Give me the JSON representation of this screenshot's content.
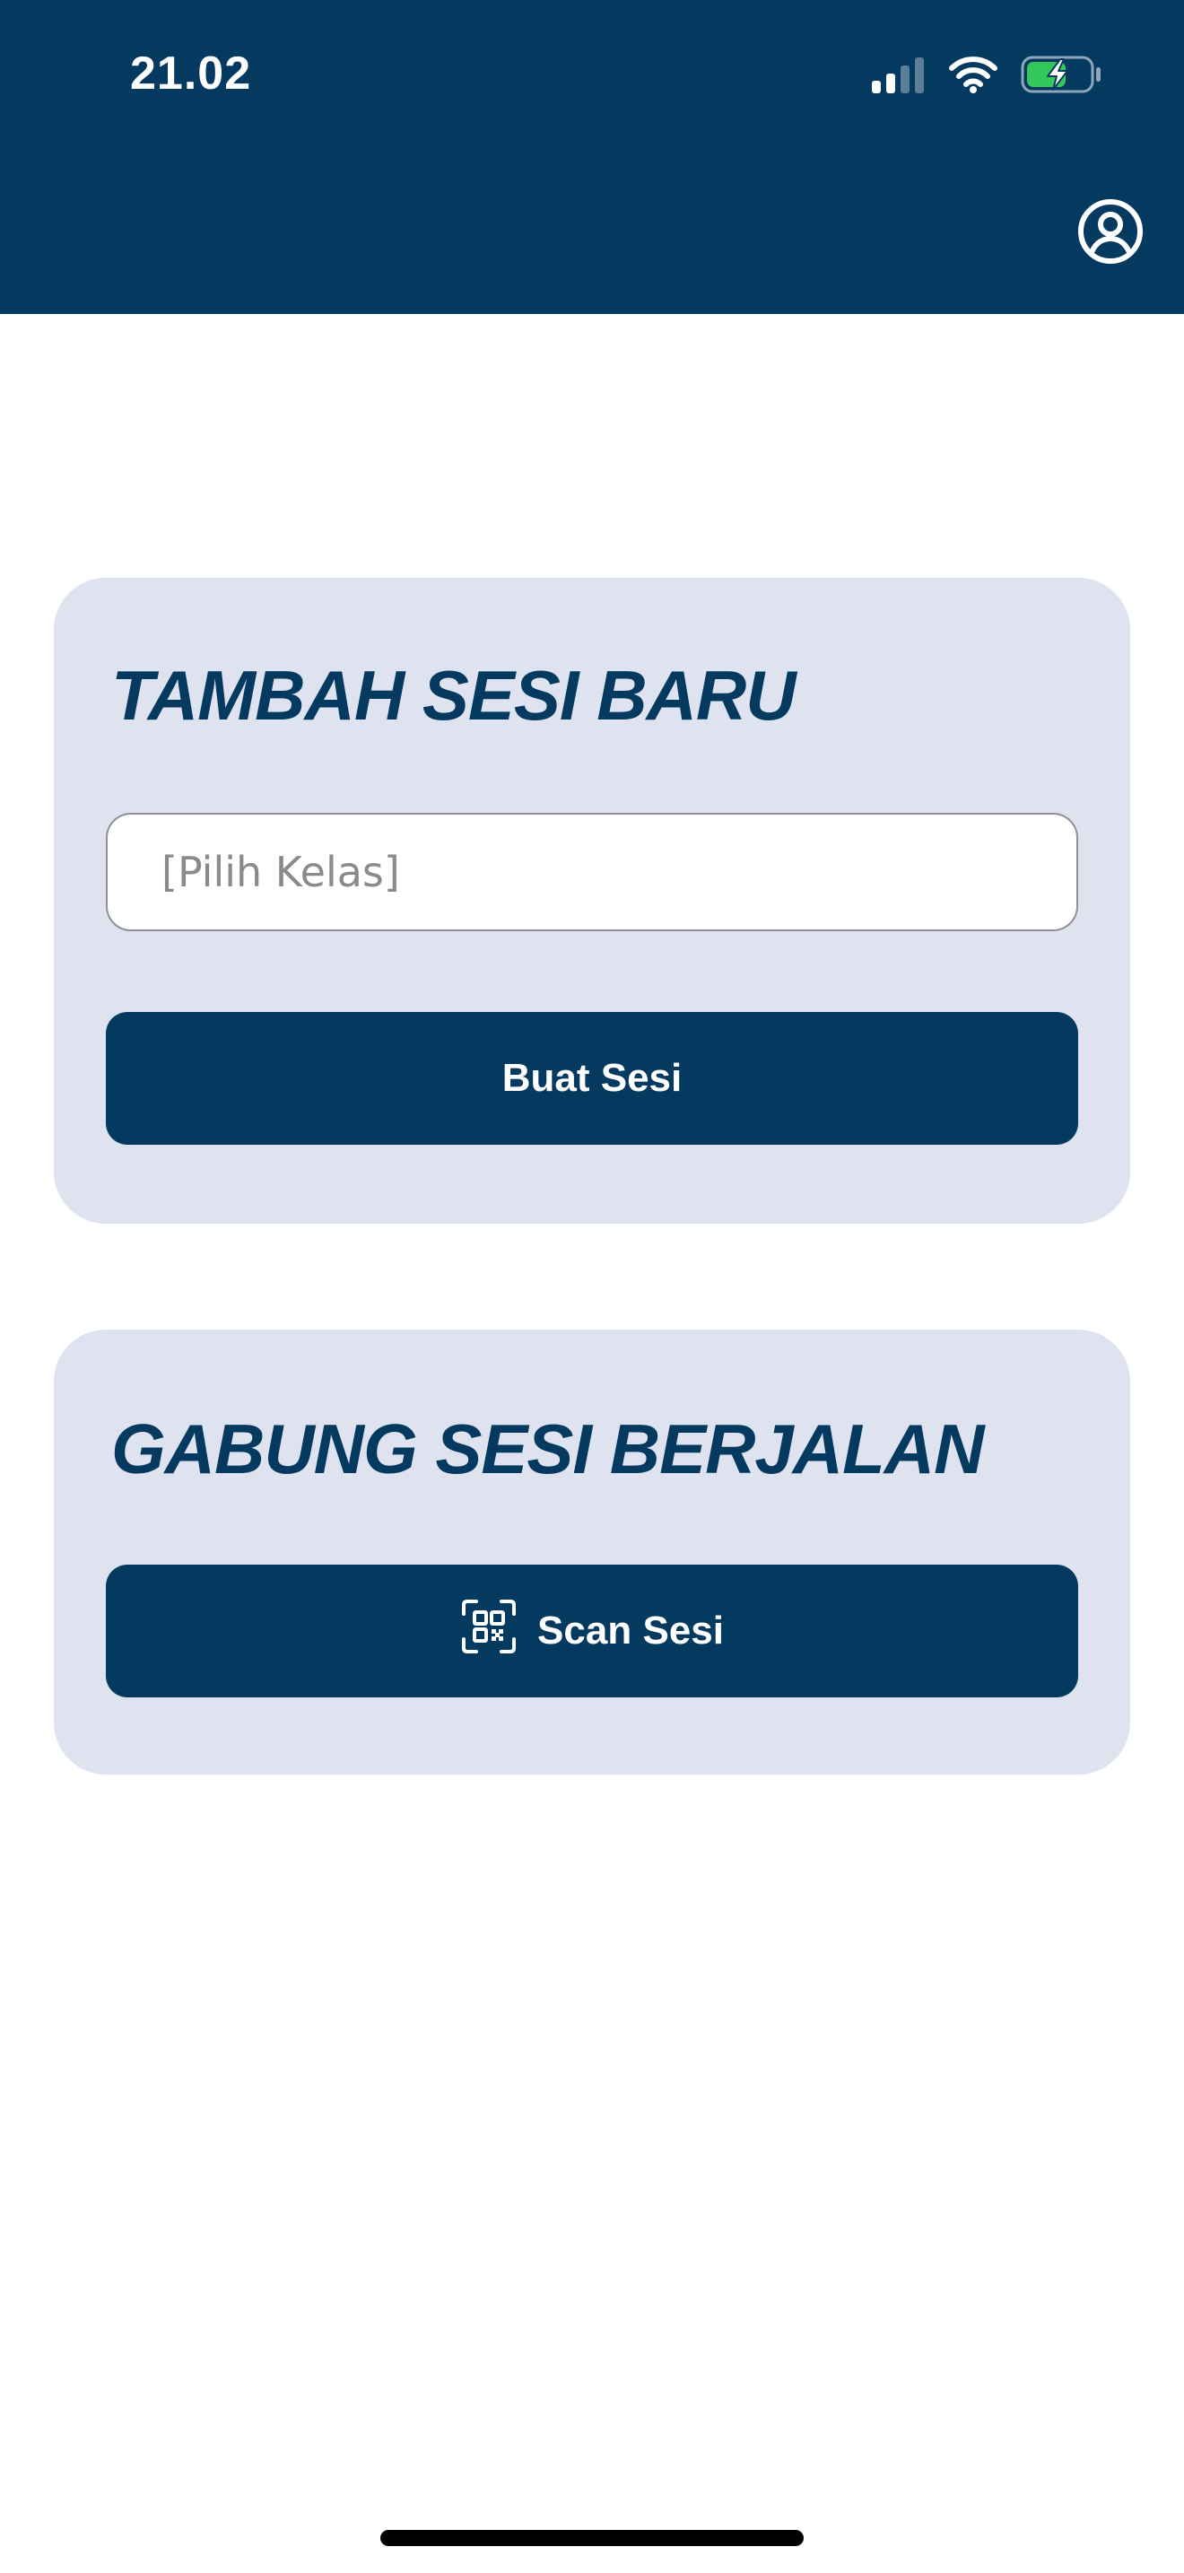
{
  "status_bar": {
    "time": "21.02",
    "icons": [
      "cellular-signal-icon",
      "wifi-icon",
      "battery-charging-icon"
    ],
    "signal_bars_active": 2,
    "signal_bars_total": 4,
    "battery_level": 0.55,
    "battery_color": "#34c759"
  },
  "header": {
    "background": "#053a60",
    "profile_icon": "user-circle-icon"
  },
  "new_session_card": {
    "title": "TAMBAH SESI BARU",
    "class_select": {
      "placeholder": "[Pilih Kelas]",
      "value": ""
    },
    "create_button_label": "Buat Sesi"
  },
  "join_session_card": {
    "title": "GABUNG SESI BERJALAN",
    "scan_button_icon": "qr-scan-icon",
    "scan_button_label": "Scan Sesi"
  },
  "colors": {
    "primary": "#053a60",
    "card_background": "#dfe3f0",
    "placeholder_text": "#8a8a8a"
  }
}
